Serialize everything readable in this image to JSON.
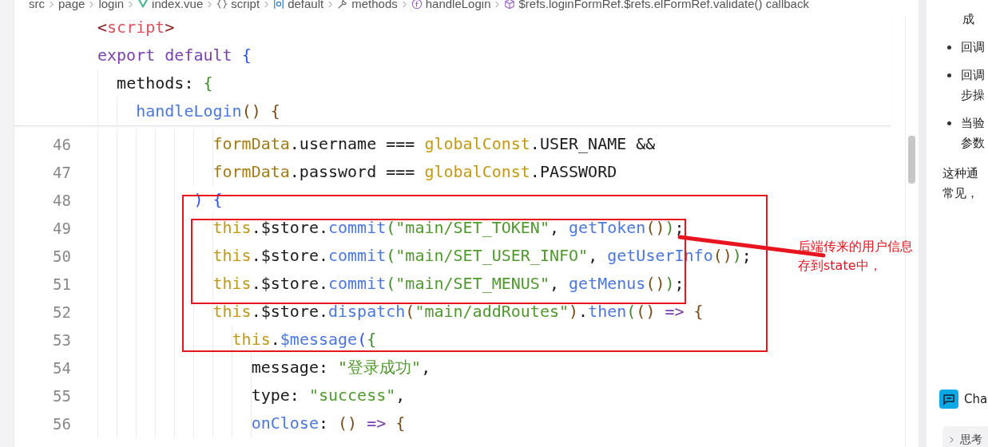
{
  "breadcrumb": [
    {
      "label": "src"
    },
    {
      "label": "page"
    },
    {
      "label": "login"
    },
    {
      "label": "index.vue",
      "kind": "vue"
    },
    {
      "label": "script",
      "kind": "braces"
    },
    {
      "label": "default",
      "kind": "module"
    },
    {
      "label": "methods",
      "kind": "wrench"
    },
    {
      "label": "handleLogin",
      "kind": "function"
    },
    {
      "label": "$refs.loginFormRef.$refs.elFormRef.validate() callback",
      "kind": "cube"
    }
  ],
  "sticky_lines": [
    {
      "tokens": [
        {
          "t": "<",
          "color": "#8a1a1a"
        },
        {
          "t": "script",
          "color": "#e0505e"
        },
        {
          "t": ">",
          "color": "#8a1a1a"
        }
      ]
    },
    {
      "tokens": [
        {
          "t": "export default ",
          "color": "#7b3fb0"
        },
        {
          "t": "{",
          "color": "#2a52e8"
        }
      ]
    },
    {
      "tokens": [
        {
          "t": "  methods: ",
          "color": "#1a1a1a"
        },
        {
          "t": "{",
          "color": "#3f8a2a"
        }
      ]
    },
    {
      "tokens": [
        {
          "t": "    handleLogin",
          "color": "#4a78e0"
        },
        {
          "t": "() {",
          "color": "#7a4a14"
        }
      ]
    }
  ],
  "lines": [
    {
      "number": "46",
      "tokens": [
        {
          "t": "            formData",
          "color": "#a57a17"
        },
        {
          "t": ".username === ",
          "color": "#1a1a1a"
        },
        {
          "t": "globalConst",
          "color": "#c49812"
        },
        {
          "t": ".USER_NAME &&",
          "color": "#1a1a1a"
        }
      ]
    },
    {
      "number": "47",
      "tokens": [
        {
          "t": "            formData",
          "color": "#a57a17"
        },
        {
          "t": ".password === ",
          "color": "#1a1a1a"
        },
        {
          "t": "globalConst",
          "color": "#c49812"
        },
        {
          "t": ".PASSWORD",
          "color": "#1a1a1a"
        }
      ]
    },
    {
      "number": "48",
      "tokens": [
        {
          "t": "          ) {",
          "color": "#2a52e8"
        }
      ]
    },
    {
      "number": "49",
      "tokens": [
        {
          "t": "            this",
          "color": "#c49812"
        },
        {
          "t": ".$store.",
          "color": "#1a1a1a"
        },
        {
          "t": "commit",
          "color": "#4a78e0"
        },
        {
          "t": "(",
          "color": "#3f8a2a"
        },
        {
          "t": "\"main/SET_TOKEN\"",
          "color": "#4e9a2c"
        },
        {
          "t": ", ",
          "color": "#1a1a1a"
        },
        {
          "t": "getToken",
          "color": "#4a78e0"
        },
        {
          "t": "()",
          "color": "#7a4a14"
        },
        {
          "t": ")",
          "color": "#3f8a2a"
        },
        {
          "t": ";",
          "color": "#1a1a1a"
        }
      ]
    },
    {
      "number": "50",
      "tokens": [
        {
          "t": "            this",
          "color": "#c49812"
        },
        {
          "t": ".$store.",
          "color": "#1a1a1a"
        },
        {
          "t": "commit",
          "color": "#4a78e0"
        },
        {
          "t": "(",
          "color": "#3f8a2a"
        },
        {
          "t": "\"main/SET_USER_INFO\"",
          "color": "#4e9a2c"
        },
        {
          "t": ", ",
          "color": "#1a1a1a"
        },
        {
          "t": "getUserInfo",
          "color": "#4a78e0"
        },
        {
          "t": "()",
          "color": "#7a4a14"
        },
        {
          "t": ")",
          "color": "#3f8a2a"
        },
        {
          "t": ";",
          "color": "#1a1a1a"
        }
      ]
    },
    {
      "number": "51",
      "tokens": [
        {
          "t": "            this",
          "color": "#c49812"
        },
        {
          "t": ".$store.",
          "color": "#1a1a1a"
        },
        {
          "t": "commit",
          "color": "#4a78e0"
        },
        {
          "t": "(",
          "color": "#3f8a2a"
        },
        {
          "t": "\"main/SET_MENUS\"",
          "color": "#4e9a2c"
        },
        {
          "t": ", ",
          "color": "#1a1a1a"
        },
        {
          "t": "getMenus",
          "color": "#4a78e0"
        },
        {
          "t": "()",
          "color": "#7a4a14"
        },
        {
          "t": ")",
          "color": "#3f8a2a"
        },
        {
          "t": ";",
          "color": "#1a1a1a"
        }
      ]
    },
    {
      "number": "52",
      "tokens": [
        {
          "t": "            this",
          "color": "#c49812"
        },
        {
          "t": ".$store.",
          "color": "#1a1a1a"
        },
        {
          "t": "dispatch",
          "color": "#4a78e0"
        },
        {
          "t": "(",
          "color": "#7a4a14"
        },
        {
          "t": "\"main/addRoutes\"",
          "color": "#4e9a2c"
        },
        {
          "t": ")",
          "color": "#7a4a14"
        },
        {
          "t": ".",
          "color": "#1a1a1a"
        },
        {
          "t": "then",
          "color": "#4a78e0"
        },
        {
          "t": "(",
          "color": "#3f8a2a"
        },
        {
          "t": "()",
          "color": "#7a4a14"
        },
        {
          "t": " => ",
          "color": "#7b3fb0"
        },
        {
          "t": "{",
          "color": "#7a4a14"
        }
      ]
    },
    {
      "number": "53",
      "tokens": [
        {
          "t": "              this",
          "color": "#c49812"
        },
        {
          "t": ".",
          "color": "#1a1a1a"
        },
        {
          "t": "$message",
          "color": "#4a78e0"
        },
        {
          "t": "(",
          "color": "#2a52e8"
        },
        {
          "t": "{",
          "color": "#3f8a2a"
        }
      ]
    },
    {
      "number": "54",
      "tokens": [
        {
          "t": "                message: ",
          "color": "#1a1a1a"
        },
        {
          "t": "\"登录成功\"",
          "color": "#4e9a2c"
        },
        {
          "t": ",",
          "color": "#1a1a1a"
        }
      ]
    },
    {
      "number": "55",
      "tokens": [
        {
          "t": "                type: ",
          "color": "#1a1a1a"
        },
        {
          "t": "\"success\"",
          "color": "#4e9a2c"
        },
        {
          "t": ",",
          "color": "#1a1a1a"
        }
      ]
    },
    {
      "number": "56",
      "tokens": [
        {
          "t": "                onClose",
          "color": "#4a78e0"
        },
        {
          "t": ": ",
          "color": "#1a1a1a"
        },
        {
          "t": "()",
          "color": "#7a4a14"
        },
        {
          "t": " => ",
          "color": "#7b3fb0"
        },
        {
          "t": "{",
          "color": "#7a4a14"
        }
      ]
    }
  ],
  "annotation": {
    "lines": [
      "后端传来的用户信息",
      "存到state中，"
    ]
  },
  "side_panel": {
    "items": [
      {
        "kind": "text",
        "lines": [
          "成"
        ]
      },
      {
        "kind": "bullet",
        "lines": [
          "回调"
        ]
      },
      {
        "kind": "bullet",
        "lines": [
          "回调",
          "步操"
        ]
      },
      {
        "kind": "bullet",
        "lines": [
          "当验",
          "参数"
        ]
      },
      {
        "kind": "paragraph",
        "lines": [
          "这种通",
          "常见，"
        ]
      }
    ],
    "chat_button": {
      "label": "Cha"
    },
    "chip": {
      "label": "思考"
    }
  }
}
